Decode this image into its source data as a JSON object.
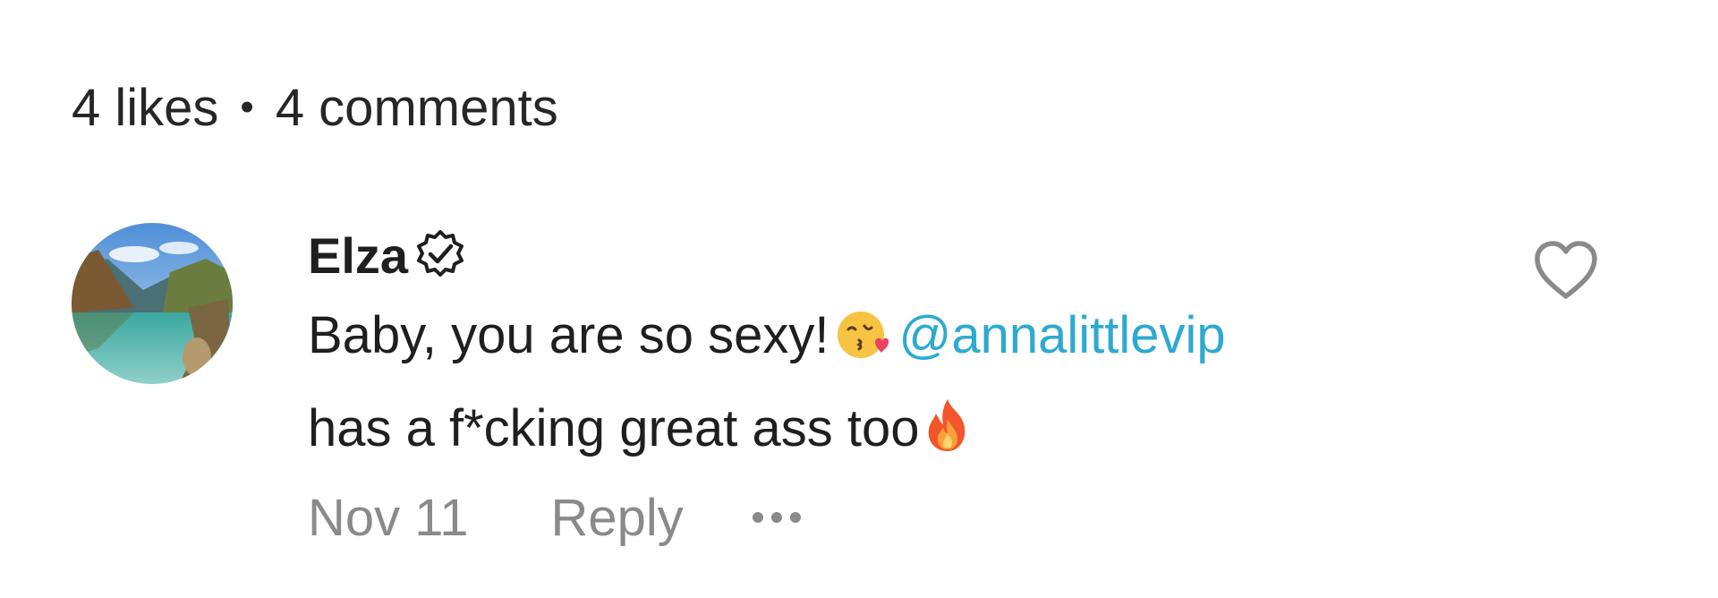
{
  "stats": {
    "likes": "4 likes",
    "separator": "•",
    "comments": "4 comments"
  },
  "comment": {
    "avatar": "landscape-lake-avatar",
    "author": "Elza",
    "verified_icon": "verified-badge-icon",
    "text_line1_prefix": "Baby, you are so sexy!",
    "emoji1": "kissing-face-heart-emoji",
    "mention": "@annalittlevip",
    "text_line2": "has a f*cking great ass too",
    "emoji2": "fire-emoji",
    "date": "Nov 11",
    "reply_label": "Reply",
    "more_icon": "ellipsis-icon",
    "like_icon": "heart-outline-icon"
  },
  "colors": {
    "text": "#1f1f1f",
    "muted": "#8a8a8a",
    "mention": "#2eaad0"
  }
}
